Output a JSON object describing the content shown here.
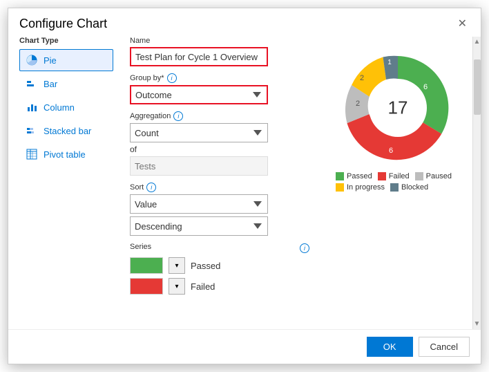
{
  "dialog": {
    "title": "Configure Chart",
    "close_label": "✕"
  },
  "chart_type": {
    "label": "Chart Type",
    "items": [
      {
        "id": "pie",
        "label": "Pie",
        "icon": "pie"
      },
      {
        "id": "bar",
        "label": "Bar",
        "icon": "bar"
      },
      {
        "id": "column",
        "label": "Column",
        "icon": "column"
      },
      {
        "id": "stacked_bar",
        "label": "Stacked bar",
        "icon": "stacked"
      },
      {
        "id": "pivot_table",
        "label": "Pivot table",
        "icon": "pivot"
      }
    ],
    "selected": "pie"
  },
  "config": {
    "name_label": "Name",
    "name_value": "Test Plan for Cycle 1 Overview",
    "group_by_label": "Group by*",
    "group_by_value": "Outcome",
    "aggregation_label": "Aggregation",
    "aggregation_value": "Count",
    "of_label": "of",
    "of_placeholder": "Tests",
    "sort_label": "Sort",
    "sort_value": "Value",
    "sort_order_value": "Descending",
    "series_label": "Series",
    "series_items": [
      {
        "color": "#4caf50",
        "label": "Passed"
      },
      {
        "color": "#e53935",
        "label": "Failed"
      }
    ]
  },
  "chart": {
    "total": "17",
    "segments": [
      {
        "label": "Passed",
        "color": "#4caf50",
        "value": 6,
        "angle_start": 0,
        "angle_end": 127
      },
      {
        "label": "Failed",
        "color": "#e53935",
        "value": 6,
        "angle_start": 127,
        "angle_end": 254
      },
      {
        "label": "Paused",
        "color": "#bdbdbd",
        "value": 2,
        "angle_start": 254,
        "angle_end": 297
      },
      {
        "label": "In progress",
        "color": "#ffc107",
        "value": 2,
        "angle_start": 297,
        "angle_end": 340
      },
      {
        "label": "Blocked",
        "color": "#607d8b",
        "value": 1,
        "angle_start": 340,
        "angle_end": 360
      }
    ],
    "legend": [
      {
        "label": "Passed",
        "color": "#4caf50"
      },
      {
        "label": "Failed",
        "color": "#e53935"
      },
      {
        "label": "Paused",
        "color": "#bdbdbd"
      },
      {
        "label": "In progress",
        "color": "#ffc107"
      },
      {
        "label": "Blocked",
        "color": "#607d8b"
      }
    ]
  },
  "footer": {
    "ok_label": "OK",
    "cancel_label": "Cancel"
  }
}
